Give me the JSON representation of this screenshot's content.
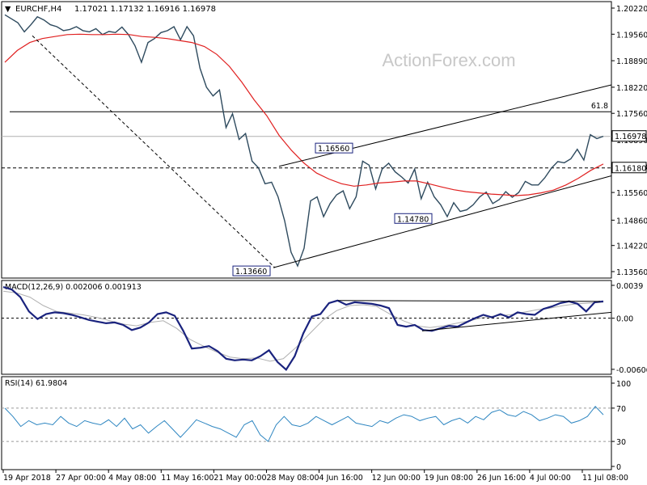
{
  "header": {
    "symbol": "EURCHF,H4",
    "ohlc": "1.17021 1.17132 1.16916 1.16978"
  },
  "watermark": "ActionForex.com",
  "colors": {
    "price": "#2e4a5e",
    "ema": "#e02020",
    "macd": "#1a237e",
    "signal": "#b0b0b0",
    "rsi": "#2e86c1",
    "line": "#000000",
    "grid": "#999999"
  },
  "chart_data": [
    {
      "type": "candlestick",
      "title": "EURCHF,H4",
      "ylim": [
        1.1356,
        1.2022
      ],
      "y_ticks": [
        "1.20220",
        "1.19560",
        "1.18890",
        "1.18220",
        "1.17560",
        "1.16890",
        "1.16220",
        "1.15560",
        "1.14860",
        "1.14220",
        "1.13560"
      ],
      "x_ticks": [
        "19 Apr 2018",
        "27 Apr 00:00",
        "4 May 08:00",
        "11 May 16:00",
        "21 May 00:00",
        "28 May 08:00",
        "4 Jun 16:00",
        "12 Jun 00:00",
        "19 Jun 08:00",
        "26 Jun 16:00",
        "4 Jul 00:00",
        "11 Jul 08:00"
      ],
      "last_price": "1.16978",
      "support_level": "1.16180",
      "fib_level": {
        "label": "61.8",
        "value": 1.176
      },
      "annotations": [
        {
          "label": "1.16560",
          "value": 1.1656
        },
        {
          "label": "1.14780",
          "value": 1.1478
        },
        {
          "label": "1.13660",
          "value": 1.1366
        }
      ],
      "series": [
        {
          "name": "price",
          "values": [
            1.2005,
            1.1995,
            1.1985,
            1.1962,
            1.198,
            1.2,
            1.1992,
            1.198,
            1.1975,
            1.1965,
            1.1968,
            1.1975,
            1.1965,
            1.1962,
            1.197,
            1.1955,
            1.1963,
            1.196,
            1.1974,
            1.1955,
            1.1927,
            1.1885,
            1.1935,
            1.1945,
            1.196,
            1.1965,
            1.1975,
            1.1942,
            1.1975,
            1.1952,
            1.187,
            1.1822,
            1.18,
            1.1815,
            1.172,
            1.1755,
            1.169,
            1.1705,
            1.1635,
            1.1618,
            1.1578,
            1.1582,
            1.1545,
            1.1485,
            1.1405,
            1.137,
            1.1415,
            1.1535,
            1.1545,
            1.1495,
            1.1528,
            1.155,
            1.156,
            1.1515,
            1.1545,
            1.1635,
            1.1625,
            1.1565,
            1.1615,
            1.163,
            1.1608,
            1.1595,
            1.158,
            1.1615,
            1.154,
            1.1582,
            1.1545,
            1.1525,
            1.1495,
            1.153,
            1.1508,
            1.1512,
            1.1525,
            1.1545,
            1.1557,
            1.1528,
            1.1538,
            1.1558,
            1.1544,
            1.1556,
            1.1584,
            1.1575,
            1.1575,
            1.1593,
            1.1617,
            1.1634,
            1.1631,
            1.1641,
            1.1665,
            1.1638,
            1.1702,
            1.1692,
            1.1698
          ]
        },
        {
          "name": "ema",
          "values": [
            1.1885,
            1.1915,
            1.1935,
            1.1945,
            1.195,
            1.1955,
            1.1956,
            1.1955,
            1.1955,
            1.1956,
            1.1955,
            1.195,
            1.1948,
            1.1945,
            1.194,
            1.1935,
            1.1925,
            1.1905,
            1.1875,
            1.1835,
            1.179,
            1.175,
            1.17,
            1.1662,
            1.163,
            1.1605,
            1.159,
            1.1578,
            1.1572,
            1.1575,
            1.158,
            1.1582,
            1.1585,
            1.1585,
            1.1578,
            1.157,
            1.1563,
            1.1558,
            1.1555,
            1.1552,
            1.155,
            1.1548,
            1.155,
            1.1555,
            1.1562,
            1.1575,
            1.1592,
            1.1612,
            1.1628
          ]
        },
        {
          "name": "channel_upper",
          "values": [
            1.1622,
            1.1828
          ]
        },
        {
          "name": "channel_lower",
          "values": [
            1.1366,
            1.1598
          ]
        },
        {
          "name": "trendline",
          "values": [
            1.1952,
            1.1366
          ]
        }
      ]
    },
    {
      "type": "line",
      "title": "MACD(12,26,9) 0.002006 0.001913",
      "ylim": [
        -0.00607,
        0.0039
      ],
      "y_ticks": [
        "0.0039",
        "0.00",
        "-0.006061"
      ],
      "series": [
        {
          "name": "MACD",
          "values": [
            0.0037,
            0.0034,
            0.0025,
            0.0008,
            -0.0001,
            0.0005,
            0.0007,
            0.0006,
            0.0004,
            0.0001,
            -0.0002,
            -0.0004,
            -0.0006,
            -0.0005,
            -0.0008,
            -0.0014,
            -0.0011,
            -0.0005,
            0.0005,
            0.0007,
            0.0003,
            -0.0015,
            -0.0036,
            -0.0035,
            -0.0033,
            -0.0039,
            -0.0048,
            -0.005,
            -0.0049,
            -0.005,
            -0.0045,
            -0.0038,
            -0.0052,
            -0.0061,
            -0.0045,
            -0.0018,
            0.0002,
            0.0005,
            0.0018,
            0.0021,
            0.0016,
            0.0019,
            0.0018,
            0.0017,
            0.0015,
            0.0012,
            -0.0008,
            -0.001,
            -0.0008,
            -0.0014,
            -0.0015,
            -0.0012,
            -0.0009,
            -0.001,
            -0.0005,
            0.0,
            0.0004,
            0.0001,
            0.0005,
            0.0001,
            0.0007,
            0.0005,
            0.0004,
            0.0011,
            0.0014,
            0.0018,
            0.002,
            0.0017,
            0.0008,
            0.0019,
            0.002
          ]
        },
        {
          "name": "Signal",
          "values": [
            0.0032,
            0.003,
            0.0025,
            0.0015,
            0.0008,
            0.0006,
            0.0004,
            0.0001,
            -0.0003,
            -0.0007,
            -0.0009,
            -0.0005,
            -0.0003,
            -0.0012,
            -0.0025,
            -0.0033,
            -0.004,
            -0.0046,
            -0.0048,
            -0.0047,
            -0.0051,
            -0.0048,
            -0.0034,
            -0.0018,
            -0.0002,
            0.0009,
            0.0015,
            0.0016,
            0.0014,
            0.0005,
            -0.0003,
            -0.0009,
            -0.0011,
            -0.0009,
            -0.0006,
            -0.0003,
            0.0001,
            0.0003,
            0.0004,
            0.0007,
            0.001,
            0.0012,
            0.0015,
            0.0017,
            0.0018,
            0.0019
          ]
        },
        {
          "name": "Trendline-top",
          "values": [
            0.0021,
            0.002
          ]
        },
        {
          "name": "Trendline-bottom",
          "values": [
            -0.0015,
            0.0007
          ]
        }
      ]
    },
    {
      "type": "line",
      "title": "RSI(14) 61.9804",
      "ylim": [
        0,
        100
      ],
      "y_ticks": [
        "100",
        "70",
        "30",
        "0"
      ],
      "series": [
        {
          "name": "RSI",
          "values": [
            70,
            60,
            48,
            55,
            50,
            52,
            50,
            60,
            52,
            48,
            55,
            52,
            50,
            56,
            48,
            58,
            45,
            50,
            40,
            48,
            55,
            45,
            35,
            45,
            56,
            52,
            48,
            45,
            40,
            35,
            50,
            55,
            38,
            30,
            50,
            60,
            50,
            48,
            52,
            60,
            55,
            50,
            55,
            60,
            52,
            50,
            48,
            55,
            52,
            58,
            62,
            60,
            55,
            58,
            60,
            50,
            55,
            58,
            52,
            60,
            56,
            65,
            68,
            62,
            60,
            66,
            62,
            55,
            58,
            62,
            60,
            52,
            55,
            60,
            72,
            62
          ]
        }
      ]
    }
  ]
}
